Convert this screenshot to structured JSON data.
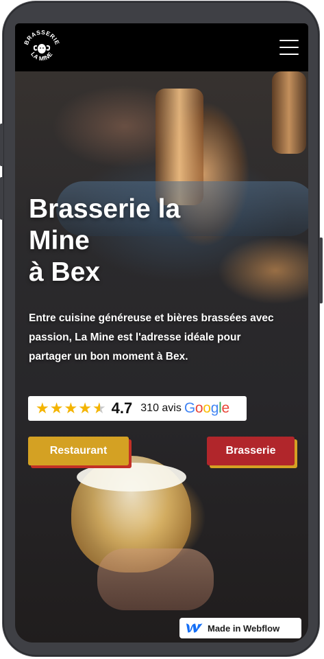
{
  "brand": {
    "logo_line1": "BRASSERIE",
    "logo_line2": "LA MINE"
  },
  "hero": {
    "title_line1": "Brasserie la",
    "title_line2": "Mine",
    "title_line3": "à Bex",
    "description": "Entre cuisine généreuse et bières brassées avec passion, La Mine est l'adresse idéale pour partager un bon moment à Bex."
  },
  "rating": {
    "stars": 4.5,
    "score": "4.7",
    "count": "310 avis",
    "google": [
      "G",
      "o",
      "o",
      "g",
      "l",
      "e"
    ]
  },
  "buttons": {
    "restaurant": "Restaurant",
    "brasserie": "Brasserie"
  },
  "badge": {
    "label": "Made in Webflow"
  },
  "colors": {
    "nav_bg": "#000000",
    "restaurant": "#d4a123",
    "brasserie": "#b1262b",
    "star": "#f4b400"
  },
  "icons": [
    "brasserie-logo",
    "menu-icon",
    "star-icon",
    "webflow-icon"
  ]
}
